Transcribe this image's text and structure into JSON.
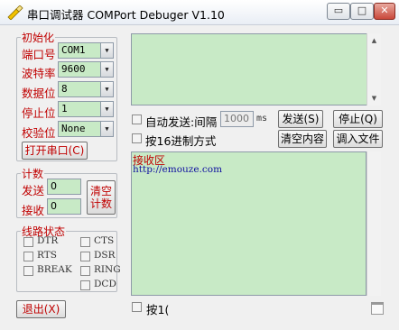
{
  "window": {
    "title": "串口调试器 COMPort Debuger V1.10",
    "min_glyph": "▭",
    "max_glyph": "□",
    "close_glyph": "✕"
  },
  "init": {
    "legend": "初始化",
    "port_label": "端口号",
    "port_value": "COM1",
    "baud_label": "波特率",
    "baud_value": "9600",
    "databits_label": "数据位",
    "databits_value": "8",
    "stopbits_label": "停止位",
    "stopbits_value": "1",
    "parity_label": "校验位",
    "parity_value": "None",
    "open_button": "打开串口(C)"
  },
  "count": {
    "legend": "计数",
    "send_label": "发送",
    "send_value": "0",
    "recv_label": "接收",
    "recv_value": "0",
    "clear_line1": "清空",
    "clear_line2": "计数"
  },
  "lines": {
    "legend": "线路状态",
    "dtr": "DTR",
    "rts": "RTS",
    "break": "BREAK",
    "cts": "CTS",
    "dsr": "DSR",
    "ring": "RING",
    "dcd": "DCD"
  },
  "exit_button": "退出(X)",
  "send": {
    "auto_send_label": "自动发送:间隔",
    "interval_value": "1000",
    "interval_unit": "ms",
    "send_button": "发送(S)",
    "stop_button": "停止(Q)",
    "hex_send_label": "按16进制方式",
    "clear_button": "清空内容",
    "load_button": "调入文件"
  },
  "receive": {
    "title": "接收区",
    "text": "http://emouze.com",
    "hex_label": "按1("
  },
  "colors": {
    "accent_red": "#c00000",
    "field_green": "#c8eac6"
  }
}
